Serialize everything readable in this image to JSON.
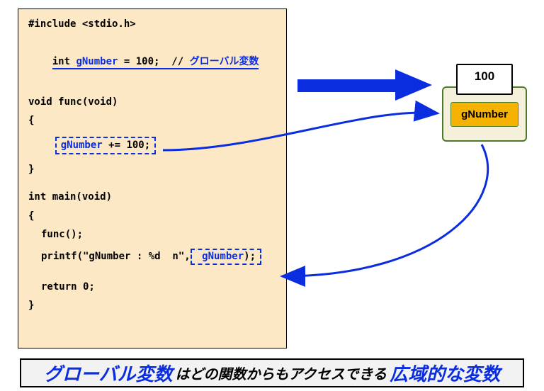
{
  "code": {
    "include": "#include <stdio.h>",
    "decl_prefix": "int ",
    "decl_var": "gNumber",
    "decl_suffix": " = 100;  // ",
    "decl_comment": "グローバル変数",
    "func_sig": "void func(void)",
    "brace_open": "{",
    "func_body_prefix": "gNumber",
    "func_body_suffix": " += 100;",
    "brace_close": "}",
    "main_sig": "int main(void)",
    "main_call": "func();",
    "printf_prefix": "printf(\"gNumber : %d  n\",",
    "printf_var": " gNumber",
    "printf_suffix": ");",
    "return": "return 0;"
  },
  "var_box": {
    "value": "100",
    "name": "gNumber"
  },
  "banner": {
    "part1": "グローバル変数",
    "mid": " はどの関数からもアクセスできる ",
    "part2": "広域的な変数"
  },
  "colors": {
    "blue": "#0a2de0",
    "amber": "#f5b200",
    "panel": "#fde8c6"
  }
}
